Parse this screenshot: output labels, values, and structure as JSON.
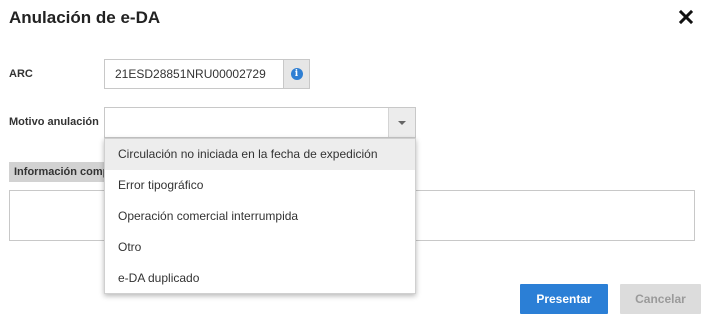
{
  "dialog": {
    "title": "Anulación de e-DA",
    "close_icon": "close-icon"
  },
  "form": {
    "arc_label": "ARC",
    "arc_value": "21ESD28851NRU00002729",
    "arc_info_icon": "info-icon",
    "motivo_label": "Motivo anulación",
    "motivo_value": "",
    "info_header": "Información complementaria",
    "info_value": ""
  },
  "dropdown": {
    "options": [
      "Circulación no iniciada en la fecha de expedición",
      "Error tipográfico",
      "Operación comercial interrumpida",
      "Otro",
      "e-DA duplicado"
    ],
    "highlighted_index": 0
  },
  "actions": {
    "presentar_label": "Presentar",
    "cancelar_label": "Cancelar"
  },
  "colors": {
    "primary": "#2b7fd6",
    "info_icon": "#2f7fd3",
    "disabled_button": "#dcdcdc"
  }
}
